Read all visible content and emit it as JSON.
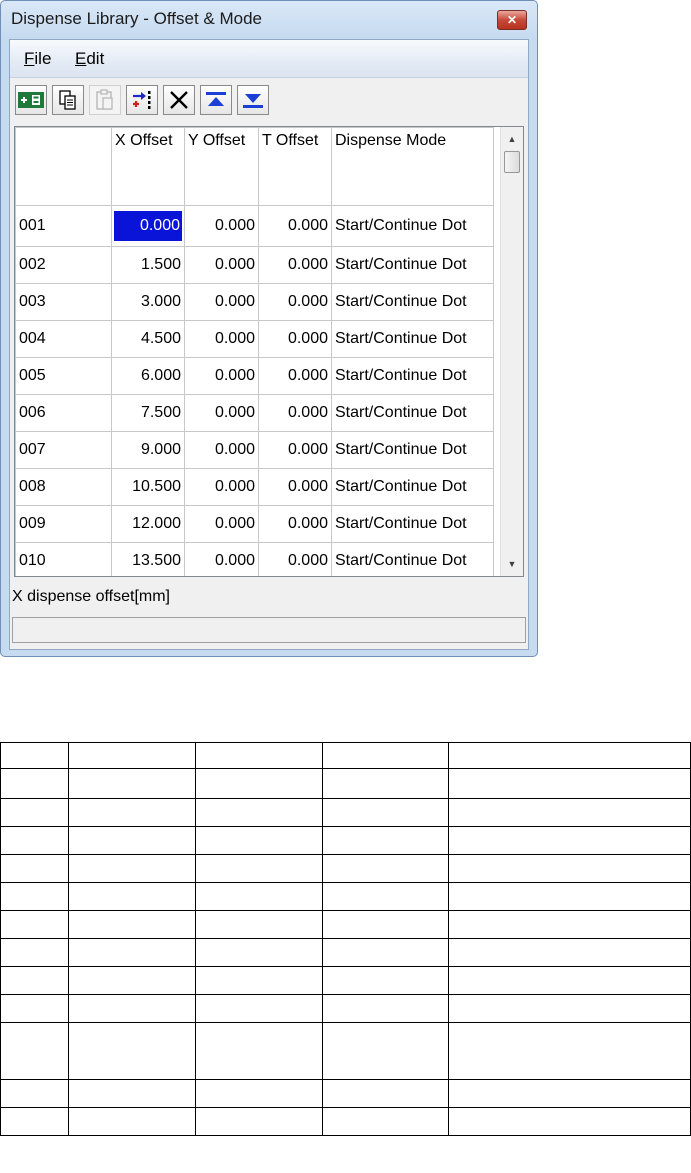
{
  "window": {
    "title": "Dispense Library - Offset & Mode",
    "close_icon": "close-icon"
  },
  "menu": {
    "file": {
      "mnemonic": "F",
      "rest": "ile"
    },
    "edit": {
      "mnemonic": "E",
      "rest": "dit"
    }
  },
  "toolbar": {
    "buttons": [
      {
        "icon": "insert-row-icon"
      },
      {
        "icon": "copy-icon"
      },
      {
        "icon": "paste-icon",
        "disabled": true
      },
      {
        "icon": "insert-point-icon"
      },
      {
        "icon": "delete-icon"
      },
      {
        "icon": "move-to-top-icon"
      },
      {
        "icon": "move-to-bottom-icon"
      }
    ]
  },
  "grid": {
    "columns": [
      "",
      "X Offset",
      "Y Offset",
      "T Offset",
      "Dispense Mode"
    ],
    "rows": [
      {
        "id": "001",
        "x": "0.000",
        "y": "0.000",
        "t": "0.000",
        "mode": "Start/Continue Dot"
      },
      {
        "id": "002",
        "x": "1.500",
        "y": "0.000",
        "t": "0.000",
        "mode": "Start/Continue Dot"
      },
      {
        "id": "003",
        "x": "3.000",
        "y": "0.000",
        "t": "0.000",
        "mode": "Start/Continue Dot"
      },
      {
        "id": "004",
        "x": "4.500",
        "y": "0.000",
        "t": "0.000",
        "mode": "Start/Continue Dot"
      },
      {
        "id": "005",
        "x": "6.000",
        "y": "0.000",
        "t": "0.000",
        "mode": "Start/Continue Dot"
      },
      {
        "id": "006",
        "x": "7.500",
        "y": "0.000",
        "t": "0.000",
        "mode": "Start/Continue Dot"
      },
      {
        "id": "007",
        "x": "9.000",
        "y": "0.000",
        "t": "0.000",
        "mode": "Start/Continue Dot"
      },
      {
        "id": "008",
        "x": "10.500",
        "y": "0.000",
        "t": "0.000",
        "mode": "Start/Continue Dot"
      },
      {
        "id": "009",
        "x": "12.000",
        "y": "0.000",
        "t": "0.000",
        "mode": "Start/Continue Dot"
      },
      {
        "id": "010",
        "x": "13.500",
        "y": "0.000",
        "t": "0.000",
        "mode": "Start/Continue Dot"
      }
    ],
    "selected_cell": {
      "row": 0,
      "column": "x"
    }
  },
  "status": {
    "description": "X dispense offset[mm]",
    "secondary": ""
  },
  "colors": {
    "selection": "#0a14d8",
    "window_frame": "#c6daf0"
  }
}
